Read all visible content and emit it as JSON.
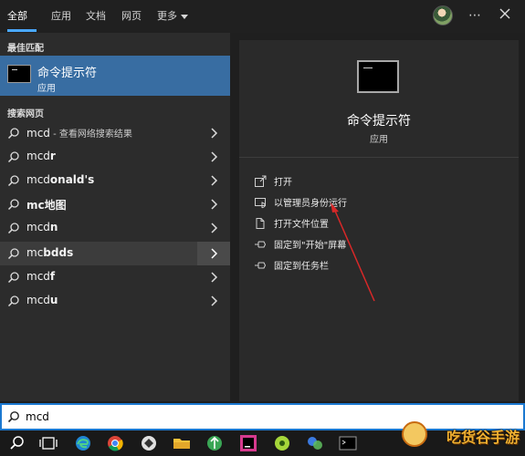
{
  "tabs": [
    {
      "label": "全部"
    },
    {
      "label": "应用"
    },
    {
      "label": "文档"
    },
    {
      "label": "网页"
    },
    {
      "label": "更多"
    }
  ],
  "window": {
    "more_icon": "⋯",
    "close_icon": "close-icon"
  },
  "best_match": {
    "section_title": "最佳匹配",
    "name": "命令提示符",
    "type": "应用"
  },
  "web_search": {
    "section_title": "搜索网页",
    "items": [
      {
        "prefix": "mcd",
        "suffix": " - 查看网络搜索结果"
      },
      {
        "prefix": "mcd",
        "bold": "r"
      },
      {
        "prefix": "mcd",
        "bold": "onald's"
      },
      {
        "prefix": "",
        "bold": "mc地图"
      },
      {
        "prefix": "mcd",
        "bold": "n"
      },
      {
        "prefix": "mc",
        "bold": "bdds"
      },
      {
        "prefix": "mcd",
        "bold": "f"
      },
      {
        "prefix": "mcd",
        "bold": "u"
      }
    ]
  },
  "detail": {
    "title": "命令提示符",
    "type": "应用",
    "actions": [
      {
        "label": "打开",
        "icon": "open-icon"
      },
      {
        "label": "以管理员身份运行",
        "icon": "shield-admin-icon"
      },
      {
        "label": "打开文件位置",
        "icon": "file-location-icon"
      },
      {
        "label": "固定到\"开始\"屏幕",
        "icon": "pin-icon"
      },
      {
        "label": "固定到任务栏",
        "icon": "pin-icon"
      }
    ]
  },
  "search": {
    "value": "mcd"
  },
  "taskbar": {
    "icons": [
      "search-icon",
      "task-view-icon",
      "edge-icon",
      "chrome-icon",
      "tool-icon",
      "file-explorer-icon",
      "app-icon",
      "jetbrains-icon",
      "app-icon",
      "app-icon",
      "terminal-icon"
    ]
  },
  "watermark": {
    "text": "吃货谷手游"
  },
  "colors": {
    "accent": "#386da2",
    "search_border": "#1b78d0",
    "annotation": "#d82828"
  }
}
